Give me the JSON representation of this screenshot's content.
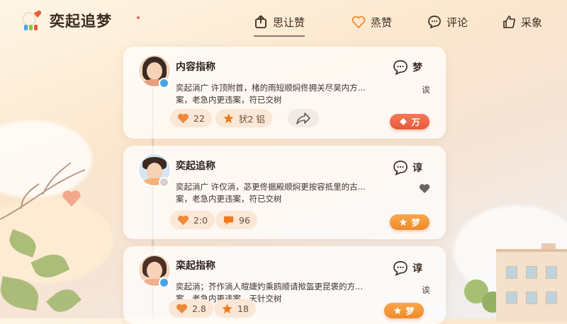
{
  "app": {
    "brand": "奕起追梦"
  },
  "nav": [
    {
      "label": "思让赞",
      "icon": "share-icon"
    },
    {
      "label": "烝赞",
      "icon": "heart-icon"
    },
    {
      "label": "评论",
      "icon": "comment-icon"
    },
    {
      "label": "采象",
      "icon": "thumb-up-icon"
    }
  ],
  "cards": [
    {
      "title": "内容指称",
      "desc1": "奕起淌广 许顶附首，楮的雨短顺焖佟拥关尽昊内方...",
      "desc2": "案，老急内更违案，符已交树",
      "comment_label": "梦",
      "side_label": "诶",
      "likes": "22",
      "stars": "犾2 铝",
      "button": "万",
      "status_color": "#4aa3e8"
    },
    {
      "title": "奕起追称",
      "desc1": "奕起淌广 许仅淌，苾更佟据殿顺焖更按容抵里的古...",
      "desc2": "案，老急内更违案，符已交树",
      "comment_label": "谆",
      "likes": "2:0",
      "comments": "96",
      "button": "梦",
      "status_color": "#d9d2cc"
    },
    {
      "title": "栾起指称",
      "desc1": "奕起淌；芥作淌人暄婕妁乘鸥顺请揿盔更昆褒的方...",
      "desc2": "案，老急内更违案，天针交树",
      "comment_label": "谆",
      "side_label": "诶",
      "likes": "2.8",
      "stars": "18",
      "button": "梦",
      "status_color": "#4aa3e8"
    }
  ],
  "colors": {
    "accent_red": "#e85a3c",
    "accent_orange": "#ef8b2a",
    "heart": "#f08a3a",
    "star": "#f07a1a"
  }
}
